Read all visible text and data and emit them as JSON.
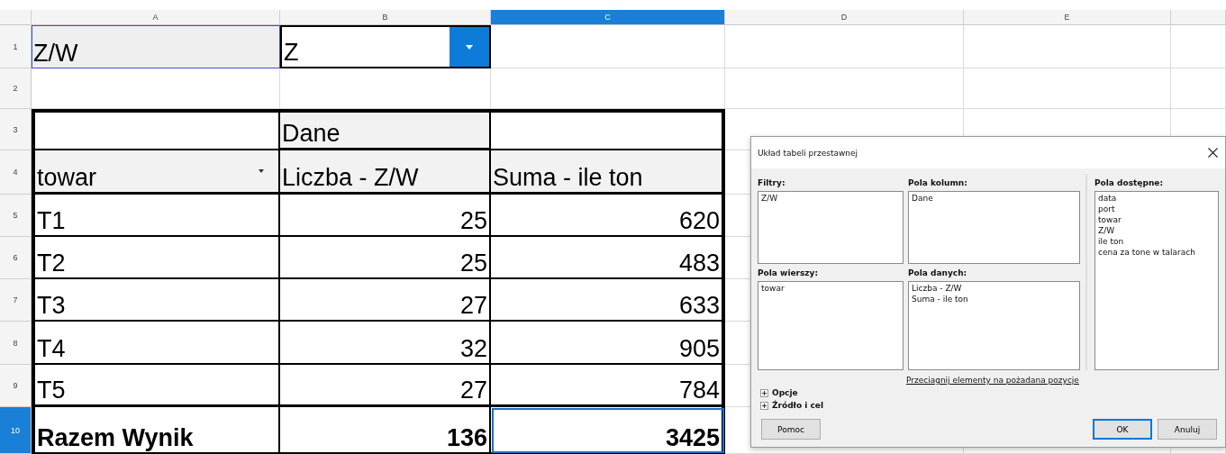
{
  "sheet": {
    "column_headers": [
      {
        "label": "A",
        "selected": false
      },
      {
        "label": "B",
        "selected": false
      },
      {
        "label": "C",
        "selected": true
      },
      {
        "label": "D",
        "selected": false
      },
      {
        "label": "E",
        "selected": false
      }
    ],
    "rows": [
      {
        "number": "1",
        "selected": false,
        "kind": "normal",
        "cells": [
          {
            "kind": "filter",
            "text": "Z/W"
          },
          {
            "kind": "dropdown",
            "text": "Z"
          },
          {
            "kind": "blank"
          },
          {
            "kind": "blank"
          },
          {
            "kind": "blank"
          },
          {
            "kind": "blank"
          }
        ]
      },
      {
        "number": "2",
        "selected": false,
        "kind": "normal",
        "cells": [
          {
            "kind": "blank"
          },
          {
            "kind": "blank"
          },
          {
            "kind": "blank"
          },
          {
            "kind": "blank"
          },
          {
            "kind": "blank"
          },
          {
            "kind": "blank"
          }
        ]
      },
      {
        "number": "3",
        "selected": false,
        "kind": "normal",
        "cells": [
          {
            "kind": "pivot-blank"
          },
          {
            "kind": "pivot-header",
            "text": "Dane"
          },
          {
            "kind": "pivot-blank"
          },
          {
            "kind": "blank"
          },
          {
            "kind": "blank"
          },
          {
            "kind": "blank"
          }
        ]
      },
      {
        "number": "4",
        "selected": false,
        "kind": "normal",
        "cells": [
          {
            "kind": "pivot-field",
            "text": "towar"
          },
          {
            "kind": "pivot-header",
            "text": "Liczba - Z/W"
          },
          {
            "kind": "pivot-header",
            "text": "Suma - ile ton"
          },
          {
            "kind": "blank"
          },
          {
            "kind": "blank"
          },
          {
            "kind": "blank"
          }
        ]
      },
      {
        "number": "5",
        "selected": false,
        "kind": "normal",
        "cells": [
          {
            "kind": "pivot-label",
            "text": "T1"
          },
          {
            "kind": "pivot-number",
            "text": "25"
          },
          {
            "kind": "pivot-number",
            "text": "620"
          },
          {
            "kind": "blank"
          },
          {
            "kind": "blank"
          },
          {
            "kind": "blank"
          }
        ]
      },
      {
        "number": "6",
        "selected": false,
        "kind": "normal",
        "cells": [
          {
            "kind": "pivot-label",
            "text": "T2"
          },
          {
            "kind": "pivot-number",
            "text": "25"
          },
          {
            "kind": "pivot-number",
            "text": "483"
          },
          {
            "kind": "blank"
          },
          {
            "kind": "blank"
          },
          {
            "kind": "blank"
          }
        ]
      },
      {
        "number": "7",
        "selected": false,
        "kind": "normal",
        "cells": [
          {
            "kind": "pivot-label",
            "text": "T3"
          },
          {
            "kind": "pivot-number",
            "text": "27"
          },
          {
            "kind": "pivot-number",
            "text": "633"
          },
          {
            "kind": "blank"
          },
          {
            "kind": "blank"
          },
          {
            "kind": "blank"
          }
        ]
      },
      {
        "number": "8",
        "selected": false,
        "kind": "normal",
        "cells": [
          {
            "kind": "pivot-label",
            "text": "T4"
          },
          {
            "kind": "pivot-number",
            "text": "32"
          },
          {
            "kind": "pivot-number",
            "text": "905"
          },
          {
            "kind": "blank"
          },
          {
            "kind": "blank"
          },
          {
            "kind": "blank"
          }
        ]
      },
      {
        "number": "9",
        "selected": false,
        "kind": "normal",
        "cells": [
          {
            "kind": "pivot-label",
            "text": "T5"
          },
          {
            "kind": "pivot-number",
            "text": "27"
          },
          {
            "kind": "pivot-number",
            "text": "784"
          },
          {
            "kind": "blank"
          },
          {
            "kind": "blank"
          },
          {
            "kind": "blank"
          }
        ]
      },
      {
        "number": "10",
        "selected": true,
        "kind": "total",
        "cells": [
          {
            "kind": "pivot-label",
            "text": "Razem Wynik"
          },
          {
            "kind": "pivot-number",
            "text": "136"
          },
          {
            "kind": "pivot-number",
            "text": "3425"
          },
          {
            "kind": "blank"
          },
          {
            "kind": "blank"
          },
          {
            "kind": "blank"
          }
        ]
      }
    ]
  },
  "dialog": {
    "title": "Układ tabeli przestawnej",
    "filters": {
      "label": "Filtry:",
      "items": [
        "Z/W"
      ]
    },
    "column_fields": {
      "label": "Pola kolumn:",
      "items": [
        "Dane"
      ]
    },
    "row_fields": {
      "label": "Pola wierszy:",
      "items": [
        "towar"
      ]
    },
    "data_fields": {
      "label": "Pola danych:",
      "items": [
        "Liczba - Z/W",
        "Suma - ile ton"
      ]
    },
    "available_fields": {
      "label": "Pola dostępne:",
      "items": [
        "data",
        "port",
        "towar",
        "Z/W",
        "ile ton",
        "cena za tone w talarach"
      ]
    },
    "hint": "Przeciagnij elementy na pożadana pozycje",
    "expanders": [
      {
        "label": "Opcje",
        "expanded": false
      },
      {
        "label": "Źródło i cel",
        "expanded": false
      }
    ],
    "buttons": [
      {
        "label": "Pomoc",
        "kind": "normal"
      },
      {
        "label": "OK",
        "kind": "default"
      },
      {
        "label": "Anuluj",
        "kind": "normal"
      }
    ]
  }
}
